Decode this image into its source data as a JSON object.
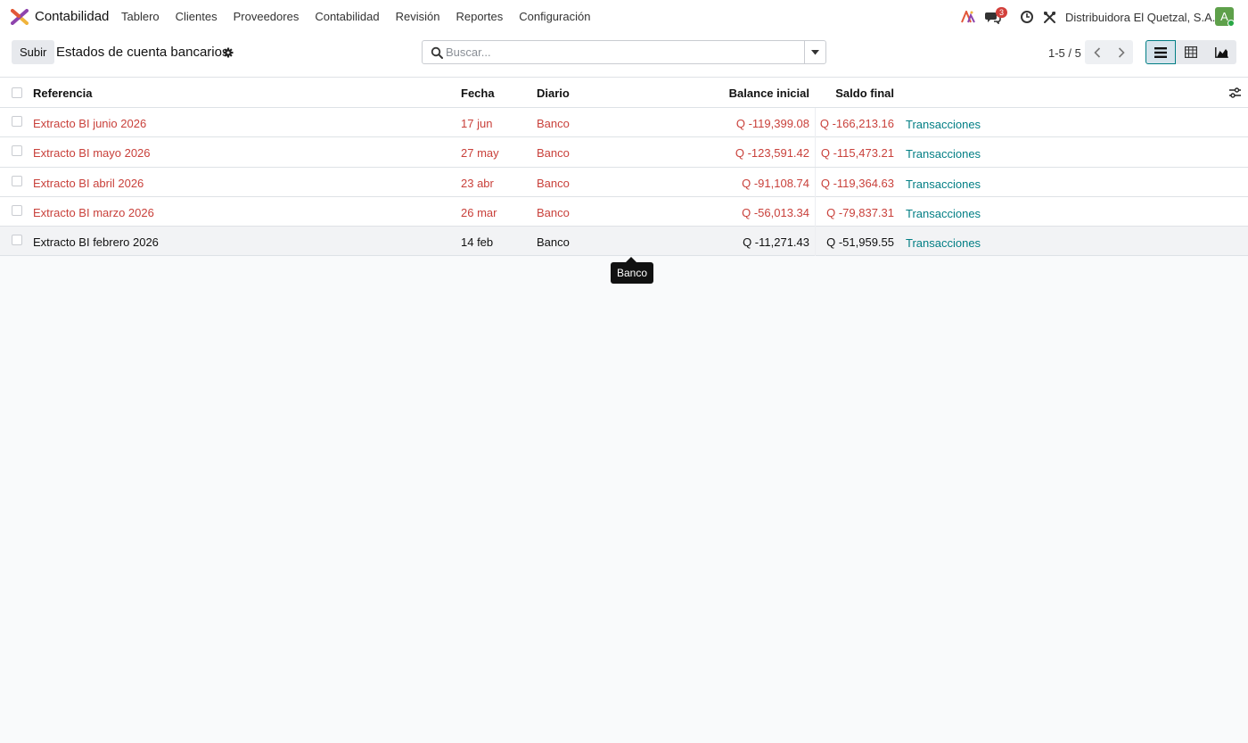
{
  "navbar": {
    "app_name": "Contabilidad",
    "menu": [
      "Tablero",
      "Clientes",
      "Proveedores",
      "Contabilidad",
      "Revisión",
      "Reportes",
      "Configuración"
    ],
    "messages_count": "3",
    "company": "Distribuidora El Quetzal, S.A.",
    "avatar_letter": "A"
  },
  "control": {
    "upload_label": "Subir",
    "title": "Estados de cuenta bancarios",
    "search_placeholder": "Buscar...",
    "pager": "1-5 / 5"
  },
  "table": {
    "headers": {
      "reference": "Referencia",
      "date": "Fecha",
      "journal": "Diario",
      "balance_start": "Balance inicial",
      "balance_end": "Saldo final"
    },
    "rows": [
      {
        "reference": "Extracto BI junio 2026",
        "date": "17 jun",
        "journal": "Banco",
        "balance_start": "Q -119,399.08",
        "balance_end": "Q -166,213.16",
        "action": "Transacciones"
      },
      {
        "reference": "Extracto BI mayo 2026",
        "date": "27 may",
        "journal": "Banco",
        "balance_start": "Q -123,591.42",
        "balance_end": "Q -115,473.21",
        "action": "Transacciones"
      },
      {
        "reference": "Extracto BI abril 2026",
        "date": "23 abr",
        "journal": "Banco",
        "balance_start": "Q -91,108.74",
        "balance_end": "Q -119,364.63",
        "action": "Transacciones"
      },
      {
        "reference": "Extracto BI marzo 2026",
        "date": "26 mar",
        "journal": "Banco",
        "balance_start": "Q -56,013.34",
        "balance_end": "Q -79,837.31",
        "action": "Transacciones"
      },
      {
        "reference": "Extracto BI febrero 2026",
        "date": "14 feb",
        "journal": "Banco",
        "balance_start": "Q -11,271.43",
        "balance_end": "Q -51,959.55",
        "action": "Transacciones"
      }
    ]
  },
  "tooltip": "Banco",
  "colors": {
    "accent": "#017e84",
    "danger_text": "#c9413b",
    "badge": "#d23f3a",
    "avatar": "#5ea04a"
  },
  "icons": [
    "app-logo-icon",
    "ai-icon",
    "chat-icon",
    "clock-icon",
    "tools-icon",
    "gear-icon",
    "search-icon",
    "caret-down-icon",
    "chevron-left-icon",
    "chevron-right-icon",
    "list-view-icon",
    "pivot-view-icon",
    "graph-view-icon",
    "column-settings-icon"
  ]
}
